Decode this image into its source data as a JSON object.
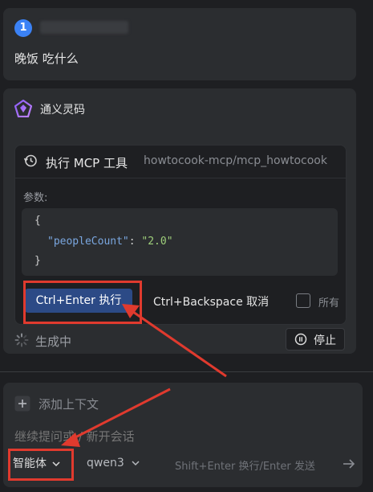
{
  "user_message": {
    "avatar_number": "1",
    "text": "晚饭 吃什么"
  },
  "assistant": {
    "name": "通义灵码",
    "tool": {
      "title": "执行 MCP 工具",
      "path": "howtocook-mcp/mcp_howtocook",
      "params_label": "参数:",
      "code": {
        "open_brace": "{",
        "key": "\"peopleCount\"",
        "colon": ": ",
        "value": "\"2.0\"",
        "close_brace": "}"
      },
      "run_button": "Ctrl+Enter 执行",
      "cancel_button": "Ctrl+Backspace 取消",
      "all_label": "所有"
    },
    "status_text": "生成中",
    "stop_button": "停止"
  },
  "input": {
    "add_context": "添加上下文",
    "placeholder": "继续提问或 / 新开会话",
    "agent_mode": "智能体",
    "model": "qwen3",
    "hint": "Shift+Enter 换行/Enter 发送"
  },
  "colors": {
    "accent_blue": "#2c4a86",
    "highlight_red": "#e03a2e",
    "avatar_blue": "#3b82f6",
    "json_key": "#7aa7e0",
    "json_value": "#9fcf7b"
  },
  "icons": [
    "history-icon",
    "spinner-icon",
    "stop-icon",
    "plus-icon",
    "chevron-down-icon",
    "send-arrow-icon",
    "tongyi-logo-icon"
  ]
}
